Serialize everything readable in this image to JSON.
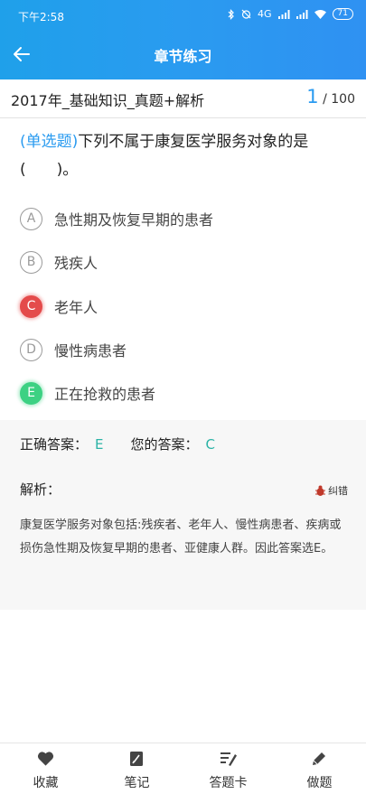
{
  "status": {
    "time": "下午2:58",
    "network": "4G",
    "battery": "71"
  },
  "header": {
    "title": "章节练习"
  },
  "subbar": {
    "paper": "2017年_基础知识_真题+解析",
    "current": "1",
    "total": "/ 100"
  },
  "question": {
    "type": "(单选题)",
    "text": "下列不属于康复医学服务对象的是(　　)。"
  },
  "options": [
    {
      "letter": "A",
      "text": "急性期及恢复早期的患者",
      "state": "normal"
    },
    {
      "letter": "B",
      "text": "残疾人",
      "state": "normal"
    },
    {
      "letter": "C",
      "text": "老年人",
      "state": "wrong"
    },
    {
      "letter": "D",
      "text": "慢性病患者",
      "state": "normal"
    },
    {
      "letter": "E",
      "text": "正在抢救的患者",
      "state": "correct"
    }
  ],
  "answer": {
    "correct_label": "正确答案：",
    "correct": "E",
    "yours_label": "您的答案：",
    "yours": "C"
  },
  "explanation": {
    "label": "解析：",
    "report": "纠错",
    "text": "康复医学服务对象包括:残疾者、老年人、慢性病患者、疾病或损伤急性期及恢复早期的患者、亚健康人群。因此答案选E。"
  },
  "tabs": [
    {
      "label": "收藏",
      "icon": "heart-icon"
    },
    {
      "label": "笔记",
      "icon": "note-icon"
    },
    {
      "label": "答题卡",
      "icon": "answer-card-icon"
    },
    {
      "label": "做题",
      "icon": "pencil-icon"
    }
  ],
  "colors": {
    "header": "#2a9bf0",
    "wrong": "#e44b4b",
    "correct": "#3dd183",
    "answer": "#2bb3a6"
  }
}
